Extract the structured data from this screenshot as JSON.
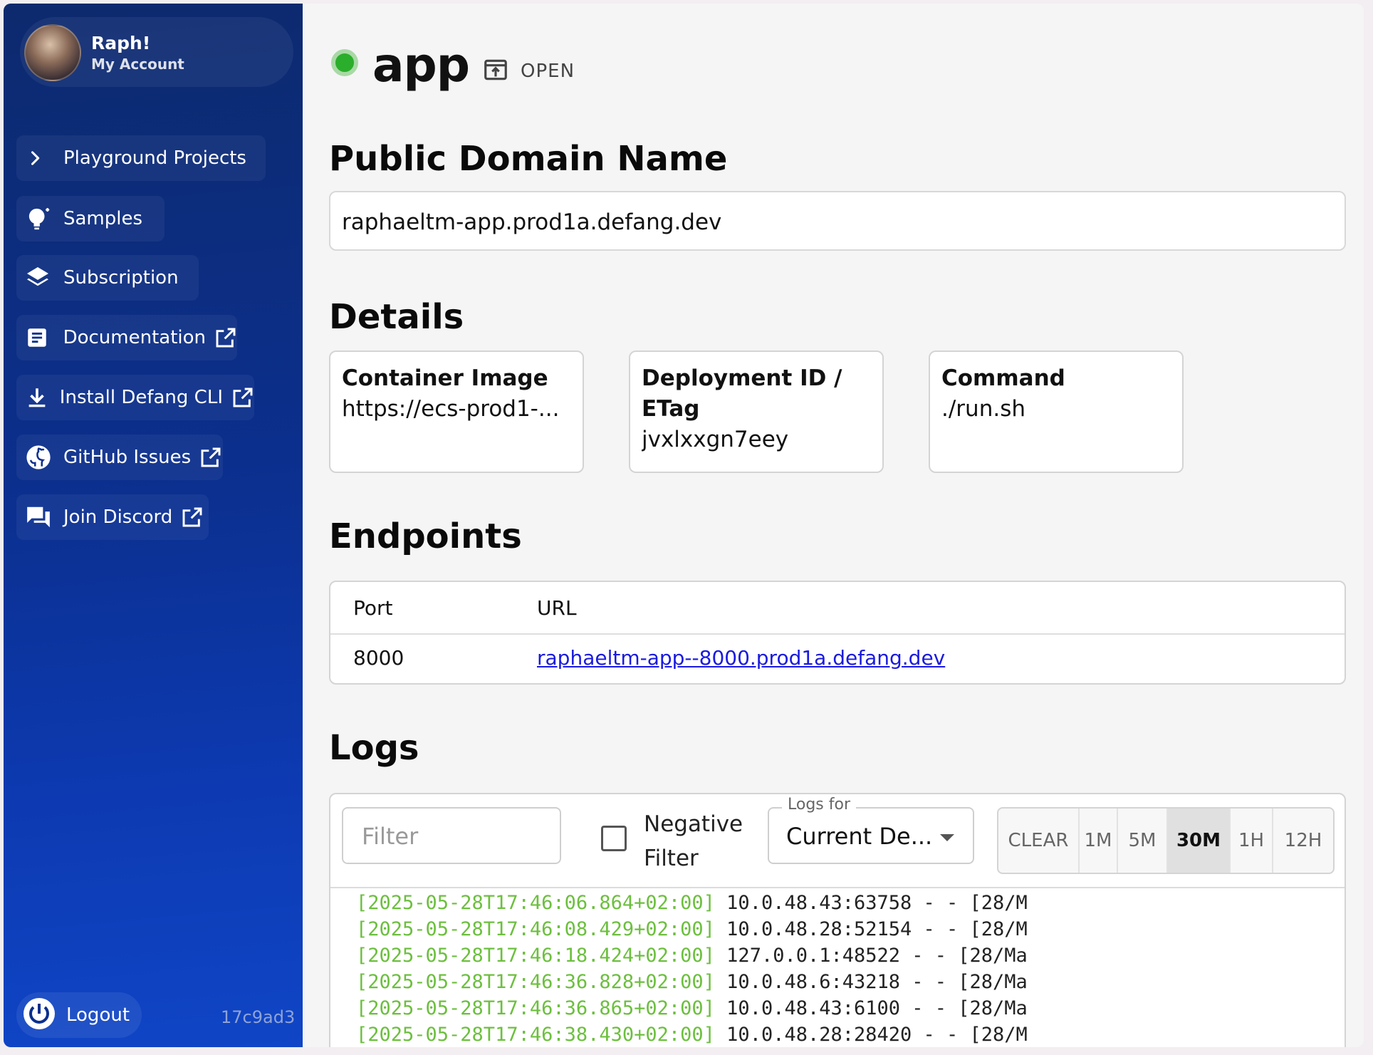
{
  "account": {
    "name": "Raph!",
    "subtitle": "My Account"
  },
  "nav": [
    {
      "label": "Playground Projects",
      "icon": "chevron-right-icon",
      "external": false
    },
    {
      "label": "Samples",
      "icon": "lightbulb-icon",
      "external": false
    },
    {
      "label": "Subscription",
      "icon": "layers-icon",
      "external": false
    },
    {
      "label": "Documentation",
      "icon": "document-icon",
      "external": true
    },
    {
      "label": "Install Defang CLI",
      "icon": "download-icon",
      "external": true
    },
    {
      "label": "GitHub Issues",
      "icon": "github-icon",
      "external": true
    },
    {
      "label": "Join Discord",
      "icon": "chat-icon",
      "external": true
    }
  ],
  "logout": {
    "label": "Logout"
  },
  "version": "17c9ad3",
  "service": {
    "name": "app",
    "status_color": "#2bae2b",
    "open_label": "OPEN"
  },
  "domain": {
    "heading": "Public Domain Name",
    "value": "raphaeltm-app.prod1a.defang.dev"
  },
  "details": {
    "heading": "Details",
    "cards": [
      {
        "title": "Container Image",
        "value": "https://ecs-prod1-..."
      },
      {
        "title_line1": "Deployment ID /",
        "title_line2": "ETag",
        "value": "jvxlxxgn7eey"
      },
      {
        "title": "Command",
        "value": "./run.sh"
      }
    ]
  },
  "endpoints": {
    "heading": "Endpoints",
    "columns": [
      "Port",
      "URL"
    ],
    "rows": [
      {
        "port": "8000",
        "url": "raphaeltm-app--8000.prod1a.defang.dev"
      }
    ]
  },
  "logs": {
    "heading": "Logs",
    "filter_placeholder": "Filter",
    "negative_line1": "Negative",
    "negative_line2": "Filter",
    "logs_for_label": "Logs for",
    "logs_for_value": "Current De...",
    "ranges": [
      "CLEAR",
      "1M",
      "5M",
      "30M",
      "1H",
      "12H"
    ],
    "active_range": "30M",
    "lines": [
      {
        "ts": "[2025-05-28T17:46:06.864+02:00]",
        "msg": " 10.0.48.43:63758 - - [28/M"
      },
      {
        "ts": "[2025-05-28T17:46:08.429+02:00]",
        "msg": " 10.0.48.28:52154 - - [28/M"
      },
      {
        "ts": "[2025-05-28T17:46:18.424+02:00]",
        "msg": " 127.0.0.1:48522 - - [28/Ma"
      },
      {
        "ts": "[2025-05-28T17:46:36.828+02:00]",
        "msg": " 10.0.48.6:43218 - - [28/Ma"
      },
      {
        "ts": "[2025-05-28T17:46:36.865+02:00]",
        "msg": " 10.0.48.43:6100 - - [28/Ma"
      },
      {
        "ts": "[2025-05-28T17:46:38.430+02:00]",
        "msg": " 10.0.48.28:28420 - - [28/M"
      }
    ]
  }
}
